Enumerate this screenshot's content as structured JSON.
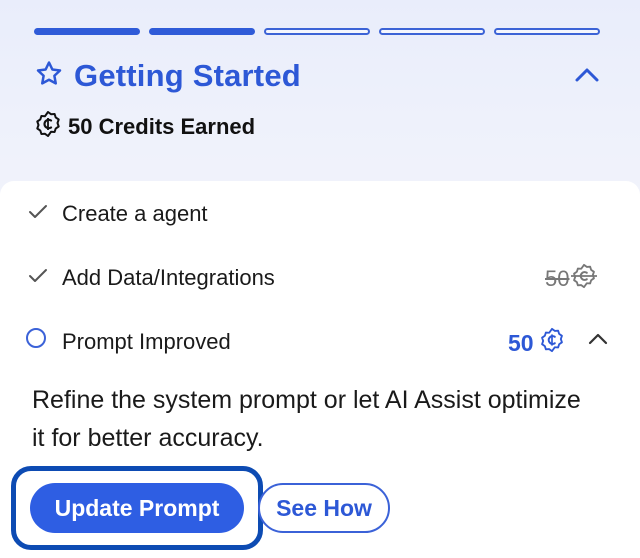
{
  "colors": {
    "accent": "#2d58d6",
    "progress_done": "#2f5bd8",
    "focus_ring": "#0d4bb3"
  },
  "progress": {
    "completed_segments": 2,
    "total_segments": 5
  },
  "header": {
    "icon": "star-icon",
    "title": "Getting Started",
    "collapse_icon": "chevron-up-icon",
    "credits_icon": "credit-coin-icon",
    "credits_text": "50 Credits Earned"
  },
  "tasks": [
    {
      "label": "Create a agent",
      "status": "done",
      "icon": "checkmark-icon"
    },
    {
      "label": "Add Data/Integrations",
      "status": "done",
      "icon": "checkmark-icon",
      "reward": "50",
      "reward_icon": "credit-coin-icon"
    },
    {
      "label": "Prompt Improved",
      "status": "pending",
      "icon": "empty-circle-icon",
      "reward": "50",
      "reward_icon": "credit-coin-icon",
      "expand_icon": "chevron-up-icon"
    }
  ],
  "active_task": {
    "description": "Refine the system prompt or let AI Assist optimize it for better accuracy.",
    "primary_button": "Update Prompt",
    "secondary_button": "See How"
  }
}
